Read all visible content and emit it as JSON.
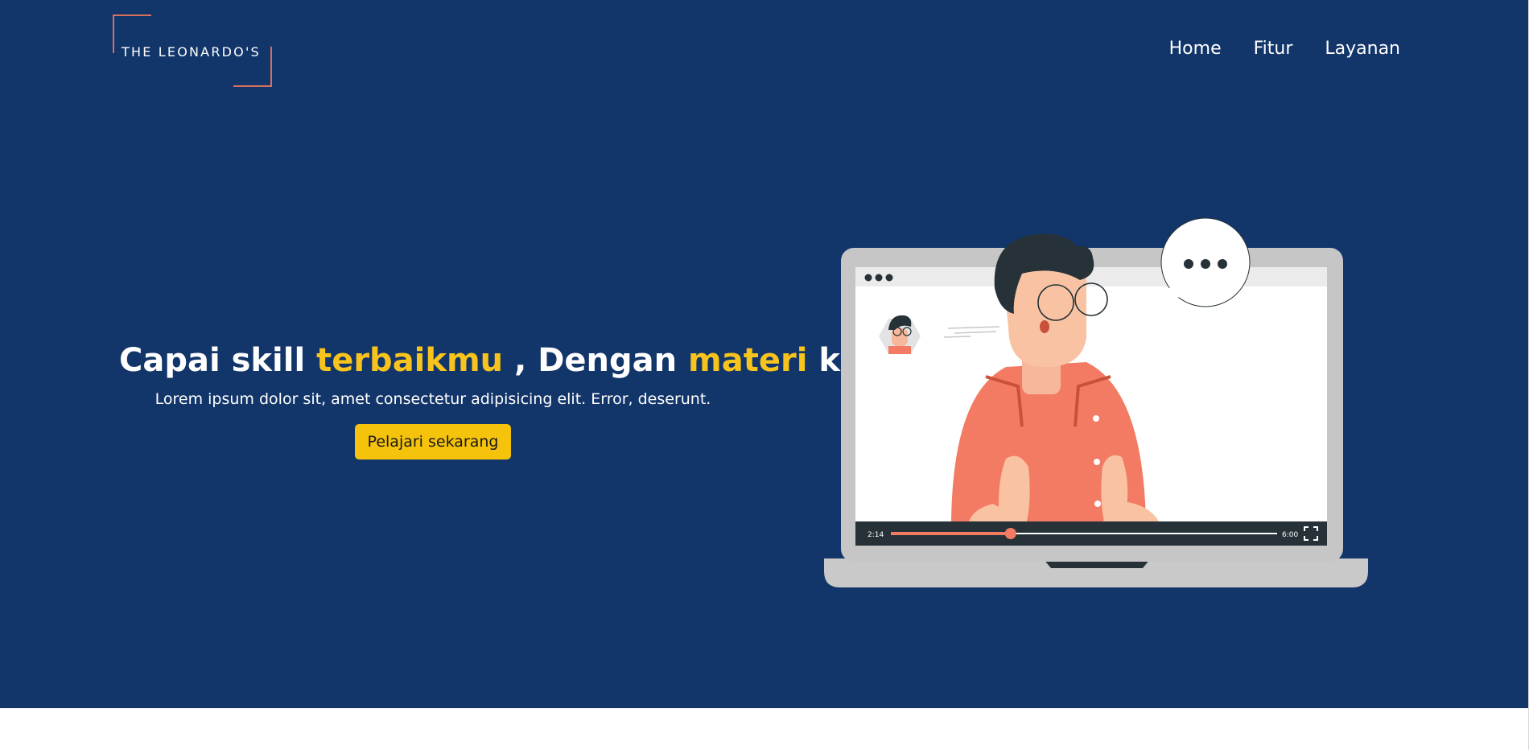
{
  "brand": {
    "name": "THE LEONARDO'S",
    "accent_color": "#d9705f"
  },
  "nav": {
    "items": [
      {
        "label": "Home"
      },
      {
        "label": "Fitur"
      },
      {
        "label": "Layanan"
      }
    ]
  },
  "hero": {
    "background_color": "#12356a",
    "headline": {
      "part1": "Capai skill ",
      "accent1": "terbaikmu",
      "part2": " , Dengan ",
      "accent2": "materi",
      "part3": " kami",
      "accent_color": "#f7c31c"
    },
    "subtitle": "Lorem ipsum dolor sit, amet consectetur adipisicing elit. Error, deserunt.",
    "cta_label": "Pelajari sekarang",
    "cta_color": "#f5c20c"
  },
  "video_player": {
    "current_time": "2:14",
    "duration": "6:00",
    "progress_fraction": 0.31,
    "icons": [
      "window-dots-icon",
      "speech-bubble-icon",
      "fullscreen-icon"
    ]
  }
}
